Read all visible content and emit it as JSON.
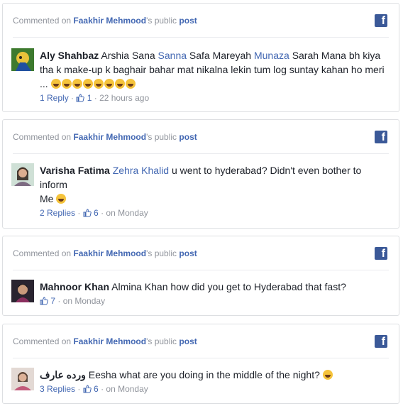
{
  "cards": [
    {
      "header": {
        "prefix": "Commented on",
        "page": "Faakhir Mehmood",
        "mid": "'s public",
        "post": "post"
      },
      "author": "Aly Shahbaz",
      "text_before": "Arshia Sana",
      "tag1": "Sanna",
      "text_mid": "Safa Mareyah",
      "tag2": "Munaza",
      "text_after": "Sarah Mana bh kiya tha k make-up k baghair bahar mat nikalna lekin tum log suntay kahan ho meri ...",
      "replies": "1 Reply",
      "likes": "1",
      "time": "22 hours ago"
    },
    {
      "header": {
        "prefix": "Commented on",
        "page": "Faakhir Mehmood",
        "mid": "'s public",
        "post": "post"
      },
      "author": "Varisha Fatima",
      "tag1": "Zehra Khalid",
      "text_after": "u went to hyderabad? Didn't even bother to inform",
      "line2": "Me",
      "replies": "2 Replies",
      "likes": "6",
      "time": "on Monday"
    },
    {
      "header": {
        "prefix": "Commented on",
        "page": "Faakhir Mehmood",
        "mid": "'s public",
        "post": "post"
      },
      "author": "Mahnoor Khan",
      "text_after": "Almina Khan how did you get to Hyderabad that fast?",
      "likes": "7",
      "time": "on Monday"
    },
    {
      "header": {
        "prefix": "Commented on",
        "page": "Faakhir Mehmood",
        "mid": "'s public",
        "post": "post"
      },
      "author": "ورده عارف",
      "text_after": "Eesha what are you doing in the middle of the night?",
      "replies": "3 Replies",
      "likes": "6",
      "time": "on Monday"
    }
  ],
  "icons": {
    "facebook": "facebook-logo-icon",
    "like": "thumbs-up-icon",
    "emoji": "laughing-emoji-icon"
  },
  "colors": {
    "link": "#4267b2",
    "muted": "#90949c",
    "fb_blue": "#3b5998",
    "border": "#dddfe2"
  }
}
